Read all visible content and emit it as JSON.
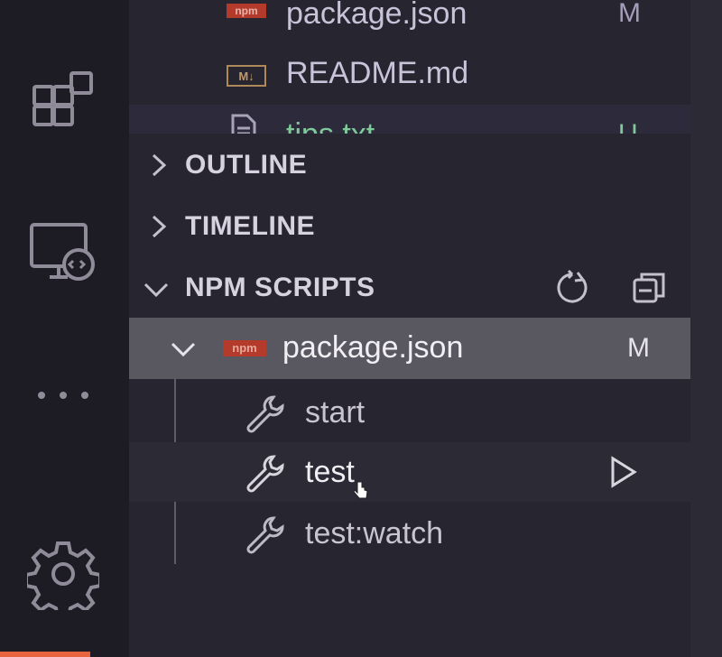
{
  "explorer": {
    "files": [
      {
        "name": "package.json",
        "status": "M",
        "icon": "npm-icon"
      },
      {
        "name": "README.md",
        "status": "",
        "icon": "markdown-icon"
      },
      {
        "name": "tips.txt",
        "status": "U",
        "icon": "file-icon"
      }
    ]
  },
  "sections": {
    "outline": "OUTLINE",
    "timeline": "TIMELINE",
    "npm_scripts": "NPM SCRIPTS"
  },
  "npm": {
    "package": {
      "name": "package.json",
      "status": "M"
    },
    "scripts": [
      "start",
      "test",
      "test:watch"
    ],
    "actions": {
      "refresh_icon": "refresh-icon",
      "collapse_icon": "collapse-all-icon",
      "run_icon": "play-icon"
    }
  },
  "activity_bar": {
    "icons": [
      "extensions-icon",
      "remote-explorer-icon",
      "more-icon",
      "gear-icon"
    ]
  },
  "colors": {
    "accent": "#e8643f",
    "selected_row": "#59575f",
    "untracked": "#7fc99a"
  }
}
